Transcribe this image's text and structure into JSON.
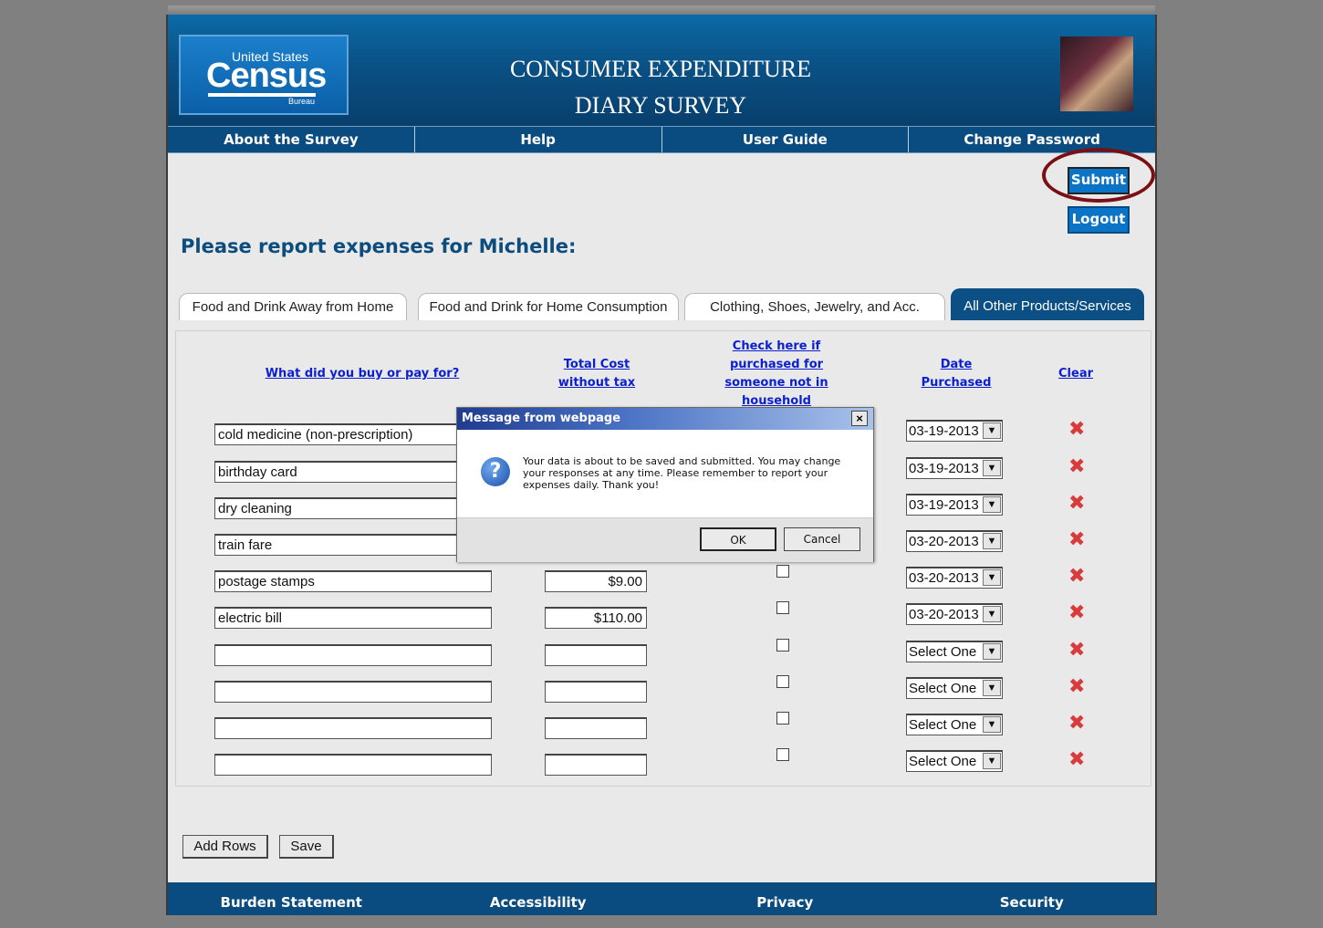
{
  "header": {
    "logo_top": "United States",
    "logo_main": "Census",
    "logo_bottom": "Bureau",
    "title_line1": "CONSUMER EXPENDITURE",
    "title_line2": "DIARY SURVEY"
  },
  "nav": [
    "About the Survey",
    "Help",
    "User Guide",
    "Change Password"
  ],
  "buttons": {
    "submit": "Submit",
    "logout": "Logout",
    "add_rows": "Add Rows",
    "save": "Save"
  },
  "heading": "Please report expenses for Michelle:",
  "tabs": [
    "Food and Drink Away from Home",
    "Food and Drink for Home Consumption",
    "Clothing, Shoes, Jewelry, and Acc.",
    "All Other Products/Services"
  ],
  "table": {
    "col_item": "What did you buy or pay for?",
    "col_cost_1": "Total Cost",
    "col_cost_2": "without tax",
    "col_check_1": "Check here if",
    "col_check_2": "purchased for",
    "col_check_3": "someone not in",
    "col_check_4": "household",
    "col_date_1": "Date",
    "col_date_2": "Purchased",
    "col_clear": "Clear",
    "rows": [
      {
        "item": "cold medicine (non-prescription)",
        "cost": "",
        "date": "03-19-2013"
      },
      {
        "item": "birthday card",
        "cost": "",
        "date": "03-19-2013"
      },
      {
        "item": "dry cleaning",
        "cost": "",
        "date": "03-19-2013"
      },
      {
        "item": "train fare",
        "cost": "",
        "date": "03-20-2013"
      },
      {
        "item": "postage stamps",
        "cost": "$9.00",
        "date": "03-20-2013"
      },
      {
        "item": "electric bill",
        "cost": "$110.00",
        "date": "03-20-2013"
      },
      {
        "item": "",
        "cost": "",
        "date": "Select One"
      },
      {
        "item": "",
        "cost": "",
        "date": "Select One"
      },
      {
        "item": "",
        "cost": "",
        "date": "Select One"
      },
      {
        "item": "",
        "cost": "",
        "date": "Select One"
      }
    ]
  },
  "dialog": {
    "title": "Message from webpage",
    "close": "×",
    "message_1": "Your data is about to be saved and submitted. You may change",
    "message_2": "your responses at any time. Please remember to report your",
    "message_3": "expenses daily. Thank you!",
    "ok": "OK",
    "cancel": "Cancel"
  },
  "footer": [
    "Burden Statement",
    "Accessibility",
    "Privacy",
    "Security"
  ]
}
